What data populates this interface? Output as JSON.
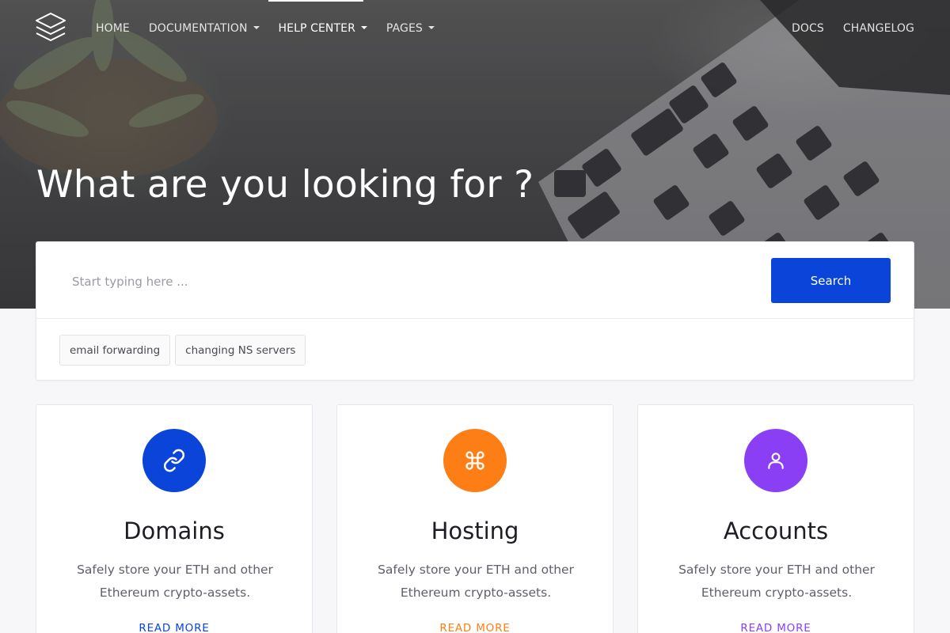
{
  "nav": {
    "left": [
      {
        "label": "HOME",
        "dropdown": false,
        "active": false
      },
      {
        "label": "DOCUMENTATION",
        "dropdown": true,
        "active": false
      },
      {
        "label": "HELP CENTER",
        "dropdown": true,
        "active": true
      },
      {
        "label": "PAGES",
        "dropdown": true,
        "active": false
      }
    ],
    "right": [
      {
        "label": "DOCS"
      },
      {
        "label": "CHANGELOG"
      }
    ]
  },
  "hero": {
    "title": "What are you looking for ?"
  },
  "search": {
    "placeholder": "Start typing here ...",
    "button_label": "Search",
    "tags": [
      "email forwarding",
      "changing NS servers"
    ]
  },
  "cards": [
    {
      "title": "Domains",
      "description": "Safely store your ETH and other Ethereum crypto-assets.",
      "link_label": "READ MORE",
      "icon": "link-icon",
      "color": "#0b44d8"
    },
    {
      "title": "Hosting",
      "description": "Safely store your ETH and other Ethereum crypto-assets.",
      "link_label": "READ MORE",
      "icon": "command-icon",
      "color": "#fd7e14"
    },
    {
      "title": "Accounts",
      "description": "Safely store your ETH and other Ethereum crypto-assets.",
      "link_label": "READ MORE",
      "icon": "user-icon",
      "color": "#8a3ff5"
    }
  ],
  "colors": {
    "primary": "#0b44d8",
    "orange": "#fd7e14",
    "purple": "#8a3ff5"
  }
}
